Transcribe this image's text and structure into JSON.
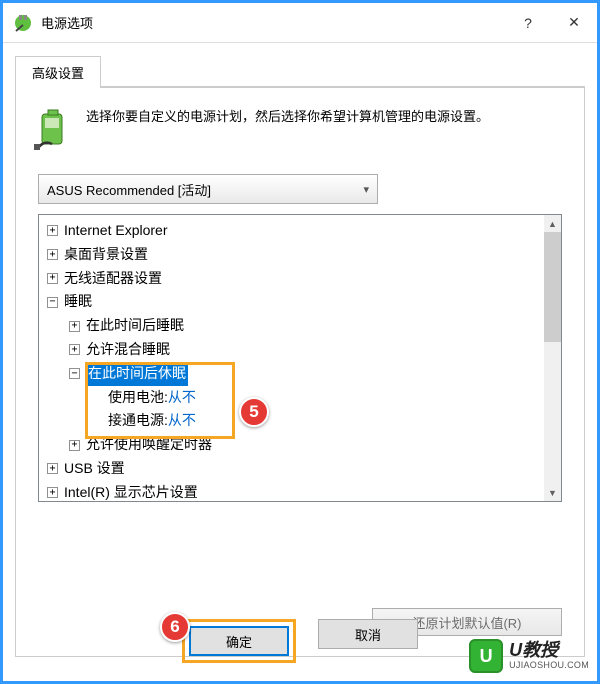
{
  "window": {
    "title": "电源选项",
    "help": "?",
    "close": "✕"
  },
  "tab": {
    "label": "高级设置"
  },
  "intro": "选择你要自定义的电源计划，然后选择你希望计算机管理的电源设置。",
  "plan_select": {
    "value": "ASUS Recommended [活动]"
  },
  "tree": {
    "n0": "Internet Explorer",
    "n1": "桌面背景设置",
    "n2": "无线适配器设置",
    "n3": "睡眠",
    "n3a": "在此时间后睡眠",
    "n3b": "允许混合睡眠",
    "n3c": "在此时间后休眠",
    "n3c_batt_label": "使用电池",
    "n3c_batt_val": "从不",
    "n3c_plug_label": "接通电源",
    "n3c_plug_val": "从不",
    "n3d": "允许使用唤醒定时器",
    "n4": "USB 设置",
    "n5": "Intel(R) 显示芯片设置"
  },
  "restore_btn": "还原计划默认值(R)",
  "buttons": {
    "ok": "确定",
    "cancel": "取消"
  },
  "badges": {
    "five": "5",
    "six": "6"
  },
  "watermark": {
    "brand": "U教授",
    "url": "UJIAOSHOU.COM"
  }
}
